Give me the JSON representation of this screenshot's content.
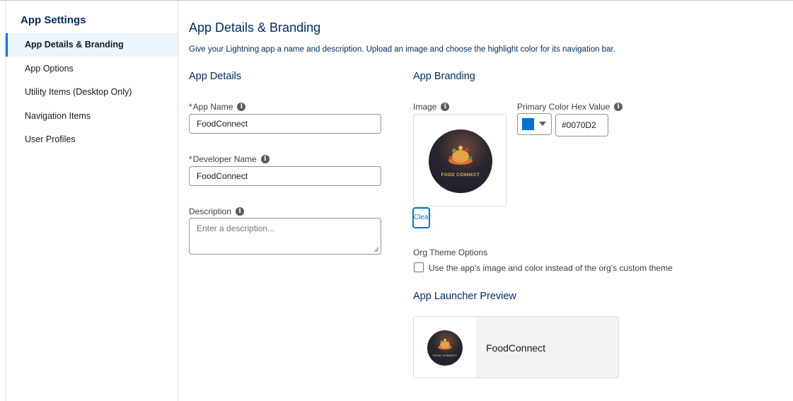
{
  "sidebar": {
    "title": "App Settings",
    "items": [
      {
        "label": "App Details & Branding",
        "active": true
      },
      {
        "label": "App Options",
        "active": false
      },
      {
        "label": "Utility Items (Desktop Only)",
        "active": false
      },
      {
        "label": "Navigation Items",
        "active": false
      },
      {
        "label": "User Profiles",
        "active": false
      }
    ]
  },
  "main": {
    "title": "App Details & Branding",
    "subtitle": "Give your Lightning app a name and description. Upload an image and choose the highlight color for its navigation bar.",
    "details": {
      "heading": "App Details",
      "required_mark": "*",
      "app_name_label": "App Name",
      "app_name_value": "FoodConnect",
      "developer_name_label": "Developer Name",
      "developer_name_value": "FoodConnect",
      "description_label": "Description",
      "description_placeholder": "Enter a description..."
    },
    "branding": {
      "heading": "App Branding",
      "image_label": "Image",
      "logo_text": "FOOD CONNECT",
      "clear_label": "Clear",
      "color_label": "Primary Color Hex Value",
      "color_value": "#0070D2",
      "swatch_color": "#0070d2",
      "org_theme_label": "Org Theme Options",
      "org_theme_checkbox_label": "Use the app's image and color instead of the org's custom theme",
      "org_theme_checked": false
    },
    "preview": {
      "heading": "App Launcher Preview",
      "app_name": "FoodConnect"
    }
  },
  "icons": [
    "info-icon",
    "chevron-down-icon",
    "resize-grip-icon"
  ]
}
